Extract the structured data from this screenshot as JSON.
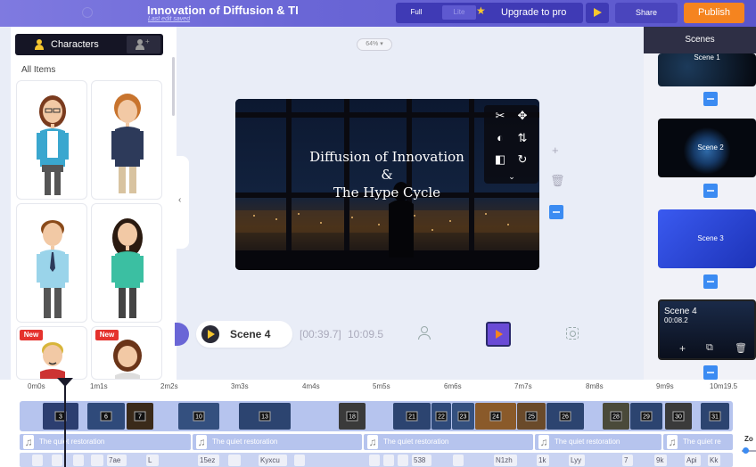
{
  "header": {
    "project_title": "Innovation of Diffusion & TI",
    "last_edit": "Last edit saved",
    "mode_full": "Full",
    "mode_lite": "Lite",
    "upgrade_label": "Upgrade to pro",
    "share_label": "Share",
    "publish_label": "Publish"
  },
  "left_panel": {
    "tab_characters": "Characters",
    "all_items": "All Items",
    "cards": [
      {
        "name": "woman-glasses",
        "badge": ""
      },
      {
        "name": "man-curly",
        "badge": ""
      },
      {
        "name": "man-tie",
        "badge": ""
      },
      {
        "name": "woman-curly",
        "badge": ""
      },
      {
        "name": "man-blonde",
        "badge": "New"
      },
      {
        "name": "woman-brown",
        "badge": "New"
      }
    ]
  },
  "canvas": {
    "zoom": "64%",
    "title_lines": [
      "Diffusion of Innovation",
      "&",
      "The Hype Cycle"
    ]
  },
  "scene_bar": {
    "scene_name": "Scene 4",
    "current_time": "[00:39.7]",
    "total_time": "10:09.5"
  },
  "scenes_panel": {
    "header": "Scenes",
    "scenes": [
      {
        "label": "Scene 1"
      },
      {
        "label": "Scene 2"
      },
      {
        "label": "Scene 3"
      },
      {
        "label": "Scene 4",
        "duration": "00:08.2"
      }
    ]
  },
  "timeline": {
    "ruler": [
      "0m0s",
      "1m1s",
      "2m2s",
      "3m3s",
      "4m4s",
      "5m5s",
      "6m6s",
      "7m7s",
      "8m8s",
      "9m9s",
      "10m19.5"
    ],
    "clip_numbers": [
      "3",
      "6",
      "7",
      "10",
      "13",
      "18",
      "21",
      "22",
      "23",
      "24",
      "25",
      "26",
      "28",
      "29",
      "30",
      "31"
    ],
    "audio_segments": [
      "The quiet restoration",
      "The quiet restoration",
      "The quiet restoration",
      "The quiet restoration",
      "The quiet re"
    ],
    "char_segments": [
      "",
      "",
      "",
      "",
      "7ae",
      "L",
      "15ez",
      "",
      "Kyxcu",
      "",
      "",
      "",
      "",
      "538",
      "",
      "N1zh",
      "1k",
      "Lyy",
      "7",
      "9k",
      "Api",
      "Kk"
    ],
    "zoom_label": "Zo"
  },
  "colors": {
    "topbar": "#6a66d6",
    "accent_orange": "#f5841f",
    "accent_blue": "#3b8bf2",
    "star": "#f6c62e"
  }
}
